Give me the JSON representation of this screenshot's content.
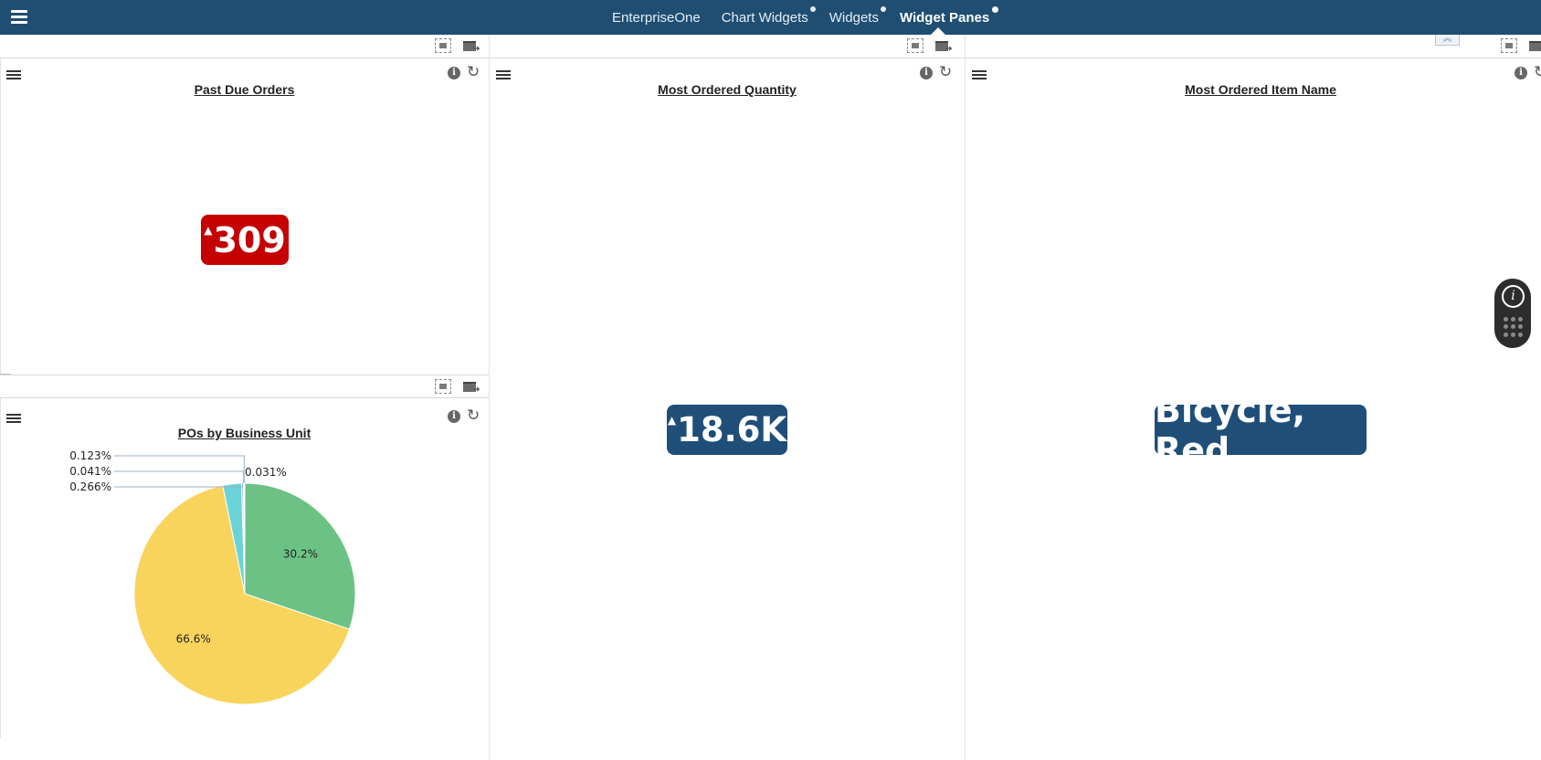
{
  "nav": {
    "tabs": [
      {
        "label": "EnterpriseOne",
        "active": false,
        "has_dot": false
      },
      {
        "label": "Chart Widgets",
        "active": false,
        "has_dot": true
      },
      {
        "label": "Widgets",
        "active": false,
        "has_dot": true
      },
      {
        "label": "Widget Panes",
        "active": true,
        "has_dot": true
      }
    ]
  },
  "widgets": {
    "past_due": {
      "title": "Past Due Orders",
      "value": "309",
      "color": "#c40000"
    },
    "po_by_bu": {
      "title": "POs by Business Unit"
    },
    "most_qty": {
      "title": "Most Ordered Quantity",
      "value": "18.6K",
      "color": "#1f4e79"
    },
    "most_item": {
      "title": "Most Ordered Item Name",
      "value": "Bicycle, Red",
      "color": "#1f4e79"
    }
  },
  "chart_data": {
    "type": "pie",
    "title": "POs by Business Unit",
    "slices": [
      {
        "value": 30.2,
        "label": "30.2%",
        "color": "#6cc285"
      },
      {
        "value": 66.6,
        "label": "66.6%",
        "color": "#f8d45c"
      },
      {
        "value": 2.74,
        "label": "",
        "color": "#6ad3d8"
      },
      {
        "value": 0.266,
        "label": "0.266%",
        "color": "#a7c4e0"
      },
      {
        "value": 0.041,
        "label": "0.041%",
        "color": "#c5d6e8"
      },
      {
        "value": 0.123,
        "label": "0.123%",
        "color": "#9ab6d2"
      },
      {
        "value": 0.031,
        "label": "0.031%",
        "color": "#b8cde0"
      }
    ]
  },
  "icons": {
    "menu": "hamburger-icon",
    "info": "info-icon",
    "refresh": "refresh-icon",
    "maximize": "maximize-icon",
    "add_pane": "add-pane-icon"
  }
}
